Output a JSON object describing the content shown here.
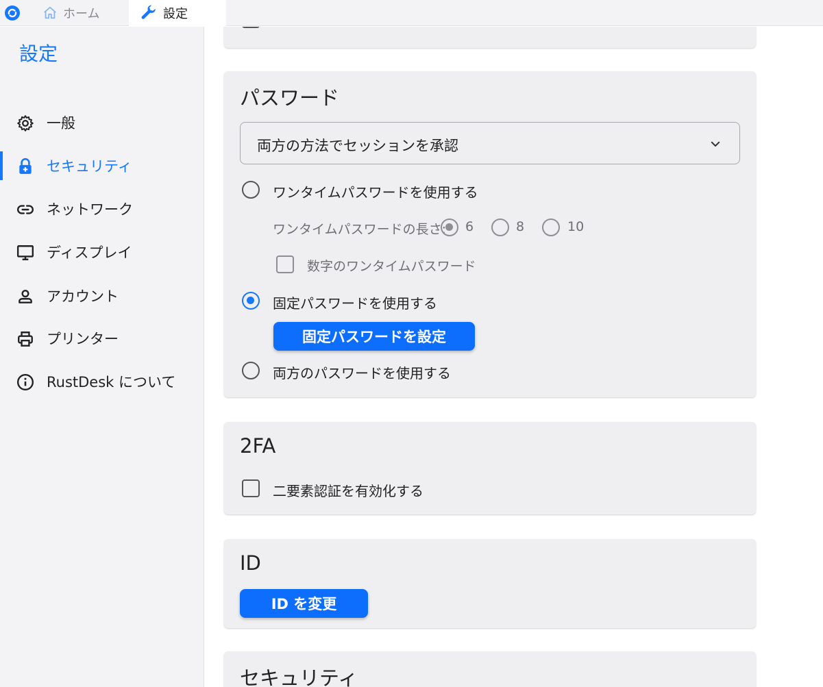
{
  "tabs": {
    "home": {
      "label": "ホーム"
    },
    "settings": {
      "label": "設定"
    }
  },
  "sidebar": {
    "title": "設定",
    "items": [
      {
        "label": "一般",
        "icon": "gear-icon"
      },
      {
        "label": "セキュリティ",
        "icon": "lock-icon",
        "active": true
      },
      {
        "label": "ネットワーク",
        "icon": "link-icon"
      },
      {
        "label": "ディスプレイ",
        "icon": "monitor-icon"
      },
      {
        "label": "アカウント",
        "icon": "person-icon"
      },
      {
        "label": "プリンター",
        "icon": "printer-icon"
      },
      {
        "label": "RustDesk について",
        "icon": "info-icon"
      }
    ]
  },
  "password_section": {
    "title": "パスワード",
    "approve_mode": {
      "selected": "両方の方法でセッションを承認"
    },
    "option_onetime": "ワンタイムパスワードを使用する",
    "onetime_length_label": "ワンタイムパスワードの長さ:",
    "onetime_lengths": [
      "6",
      "8",
      "10"
    ],
    "onetime_length_selected": "6",
    "numeric_onetime": "数字のワンタイムパスワード",
    "option_permanent": "固定パスワードを使用する",
    "set_permanent_button": "固定パスワードを設定",
    "option_both": "両方のパスワードを使用する",
    "selected_option": "permanent"
  },
  "twofa_section": {
    "title": "2FA",
    "enable_2fa": "二要素認証を有効化する"
  },
  "id_section": {
    "title": "ID",
    "change_id_button": "ID を変更"
  },
  "security_section": {
    "title": "セキュリティ"
  },
  "colors": {
    "accent": "#1677ff",
    "button": "#0d6efd",
    "card_bg": "#efeff2",
    "sidebar_bg": "#f3f3f5"
  }
}
